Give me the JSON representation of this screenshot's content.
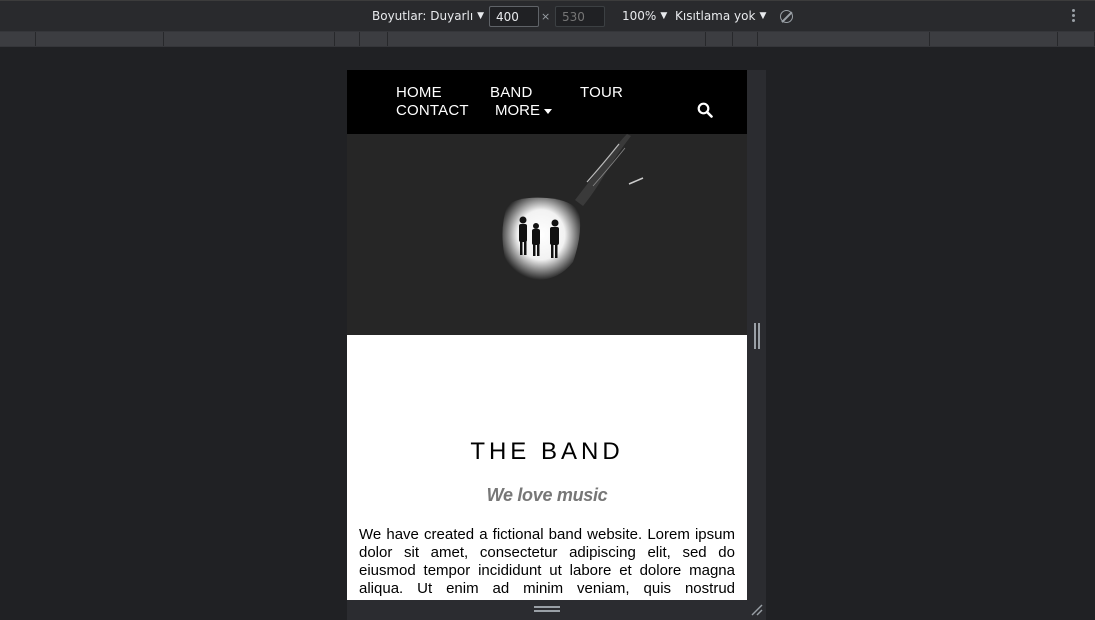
{
  "toolbar": {
    "dimensions_label": "Boyutlar: Duyarlı",
    "width_value": "400",
    "height_value": "530",
    "times": "×",
    "zoom": "100%",
    "throttling": "Kısıtlama yok"
  },
  "nav": {
    "items": [
      "HOME",
      "BAND",
      "TOUR",
      "CONTACT"
    ],
    "more": "MORE"
  },
  "band": {
    "title": "THE BAND",
    "subtitle": "We love music",
    "text": "We have created a fictional band website. Lorem ipsum dolor sit amet, consectetur adipiscing elit, sed do eiusmod tempor incididunt ut labore et dolore magna aliqua. Ut enim ad minim veniam, quis nostrud exercitation ullamco"
  },
  "colors": {
    "devtools_bg": "#202124",
    "navbar_bg": "#000000",
    "subtitle": "#777777"
  }
}
